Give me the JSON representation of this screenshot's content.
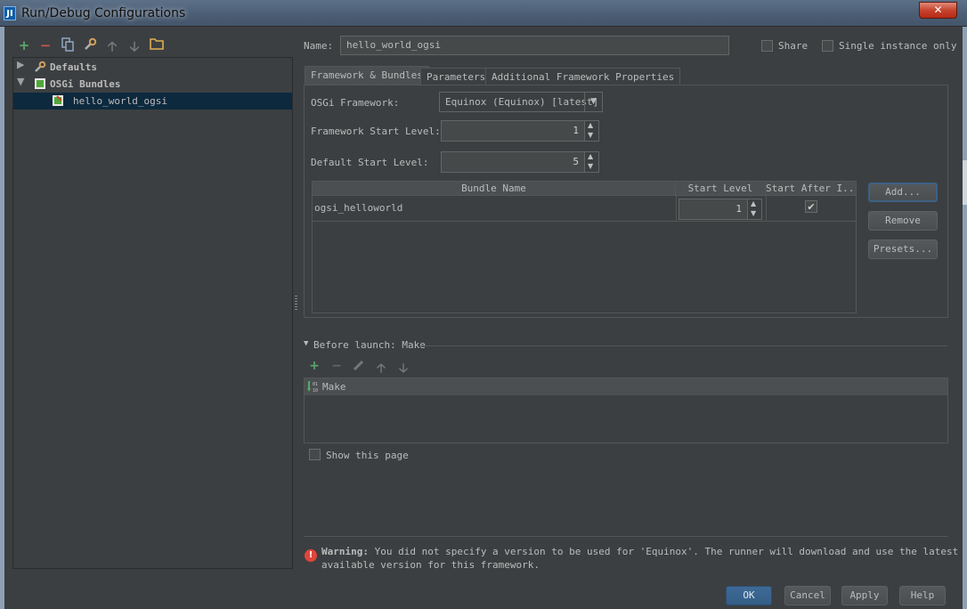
{
  "window": {
    "title": "Run/Debug Configurations",
    "close_glyph": "✕",
    "icon_text": "JI"
  },
  "left_toolbar": {
    "icons": [
      "add-icon",
      "remove-icon",
      "copy-icon",
      "settings-icon",
      "move-up-icon",
      "move-down-icon",
      "folder-icon"
    ]
  },
  "tree": {
    "items": [
      {
        "label": "Defaults",
        "expanded": false
      },
      {
        "label": "OSGi Bundles",
        "expanded": true
      },
      {
        "label": "hello_world_ogsi",
        "selected": true
      }
    ]
  },
  "name_field": {
    "label": "Name:",
    "value": "hello_world_ogsi"
  },
  "share": {
    "label": "Share",
    "checked": false
  },
  "single_instance": {
    "label": "Single instance only",
    "checked": false
  },
  "tabs": [
    {
      "label": "Framework & Bundles",
      "active": true
    },
    {
      "label": "Parameters",
      "active": false
    },
    {
      "label": "Additional Framework Properties",
      "active": false
    }
  ],
  "framework": {
    "osgi_label": "OSGi Framework:",
    "osgi_value": "Equinox (Equinox) [latest]",
    "start_level_label": "Framework Start Level:",
    "start_level_value": "1",
    "default_level_label": "Default Start Level:",
    "default_level_value": "5"
  },
  "bundle_table": {
    "columns": [
      "Bundle Name",
      "Start Level",
      "Start After I..."
    ],
    "rows": [
      {
        "name": "ogsi_helloworld",
        "start_level": "1",
        "start_after_install": true
      }
    ]
  },
  "side_buttons": {
    "add": "Add...",
    "remove": "Remove",
    "presets": "Presets..."
  },
  "before_launch": {
    "label": "Before launch: Make",
    "toolbar_icons": [
      "add-icon",
      "remove-icon",
      "edit-icon",
      "move-up-icon",
      "move-down-icon"
    ],
    "items": [
      "Make"
    ]
  },
  "show_page": {
    "label": "Show this page",
    "checked": false
  },
  "warning": {
    "title": "Warning:",
    "line1": "You did not specify a version to be used for 'Equinox'. The runner will download and use the latest",
    "line2": "available version for this framework."
  },
  "dialog_buttons": {
    "ok": "OK",
    "cancel": "Cancel",
    "apply": "Apply",
    "help": "Help"
  },
  "colors": {
    "background": "#3c3f41",
    "selection": "#0d293e",
    "accent_green": "#59a869",
    "accent_red": "#c75450",
    "default_button": "#365880"
  }
}
